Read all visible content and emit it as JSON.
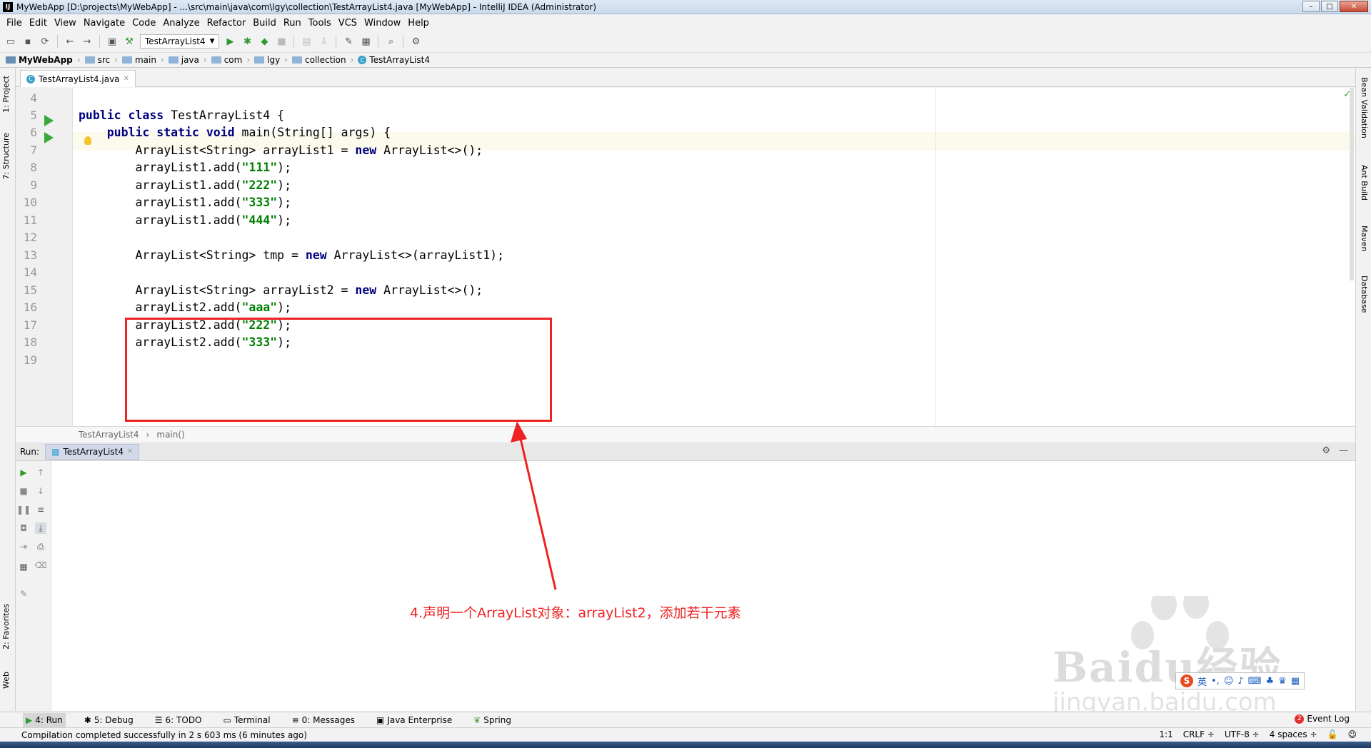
{
  "window": {
    "title": "MyWebApp [D:\\projects\\MyWebApp] - ...\\src\\main\\java\\com\\lgy\\collection\\TestArrayList4.java [MyWebApp] - IntelliJ IDEA (Administrator)",
    "app_icon": "IJ"
  },
  "menu": [
    "File",
    "Edit",
    "View",
    "Navigate",
    "Code",
    "Analyze",
    "Refactor",
    "Build",
    "Run",
    "Tools",
    "VCS",
    "Window",
    "Help"
  ],
  "toolbar": {
    "run_config": "TestArrayList4"
  },
  "breadcrumb": [
    "MyWebApp",
    "src",
    "main",
    "java",
    "com",
    "lgy",
    "collection",
    "TestArrayList4"
  ],
  "left_tabs": [
    "1: Project",
    "7: Structure",
    "2: Favorites",
    "Web"
  ],
  "right_tabs": [
    "Bean Validation",
    "Ant Build",
    "Maven",
    "Database"
  ],
  "editor": {
    "tab_label": "TestArrayList4.java",
    "lines": [
      {
        "n": "4",
        "code": ""
      },
      {
        "n": "5",
        "code": "public class TestArrayList4 {"
      },
      {
        "n": "6",
        "code": "    public static void main(String[] args) {"
      },
      {
        "n": "7",
        "code": "        ArrayList<String> arrayList1 = new ArrayList<>();"
      },
      {
        "n": "8",
        "code": "        arrayList1.add(\"111\");"
      },
      {
        "n": "9",
        "code": "        arrayList1.add(\"222\");"
      },
      {
        "n": "10",
        "code": "        arrayList1.add(\"333\");"
      },
      {
        "n": "11",
        "code": "        arrayList1.add(\"444\");"
      },
      {
        "n": "12",
        "code": ""
      },
      {
        "n": "13",
        "code": "        ArrayList<String> tmp = new ArrayList<>(arrayList1);"
      },
      {
        "n": "14",
        "code": ""
      },
      {
        "n": "15",
        "code": "        ArrayList<String> arrayList2 = new ArrayList<>();"
      },
      {
        "n": "16",
        "code": "        arrayList2.add(\"aaa\");"
      },
      {
        "n": "17",
        "code": "        arrayList2.add(\"222\");"
      },
      {
        "n": "18",
        "code": "        arrayList2.add(\"333\");"
      },
      {
        "n": "19",
        "code": ""
      }
    ],
    "code_breadcrumb": [
      "TestArrayList4",
      "main()"
    ]
  },
  "run_panel": {
    "label": "Run:",
    "tab": "TestArrayList4"
  },
  "annotation": {
    "text": "4.声明一个ArrayList对象：arrayList2，添加若干元素",
    "color": "#ee2222"
  },
  "watermark": {
    "brand": "Baidu经验",
    "url": "jingyan.baidu.com"
  },
  "ime": {
    "logo": "S",
    "mode": "英"
  },
  "bottom_tabs": [
    {
      "label": "4: Run",
      "icon": "run-icon"
    },
    {
      "label": "5: Debug",
      "icon": "debug-icon"
    },
    {
      "label": "6: TODO",
      "icon": "todo-icon"
    },
    {
      "label": "Terminal",
      "icon": "terminal-icon"
    },
    {
      "label": "0: Messages",
      "icon": "messages-icon"
    },
    {
      "label": "Java Enterprise",
      "icon": "java-enterprise-icon"
    },
    {
      "label": "Spring",
      "icon": "spring-icon"
    }
  ],
  "event_log": {
    "label": "Event Log",
    "count": "2"
  },
  "status": {
    "message": "Compilation completed successfully in 2 s 603 ms (6 minutes ago)",
    "position": "1:1",
    "line_sep": "CRLF ÷",
    "encoding": "UTF-8 ÷",
    "indent": "4 spaces ÷"
  }
}
